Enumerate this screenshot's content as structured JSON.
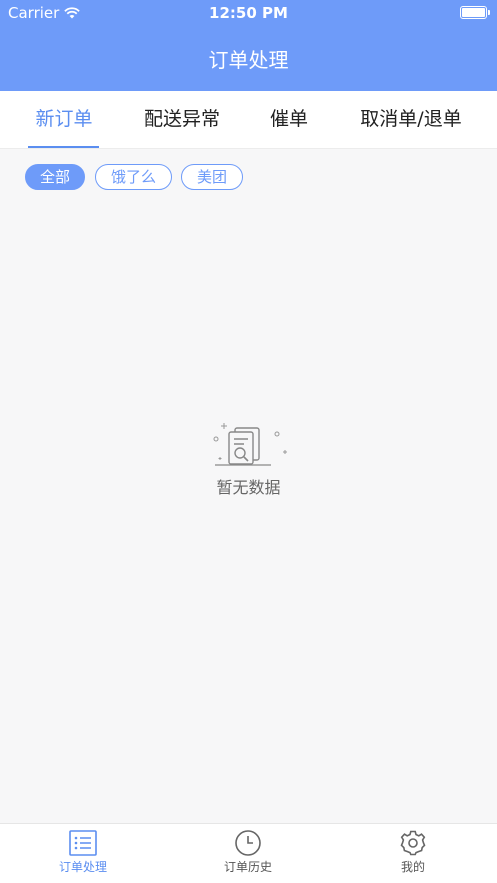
{
  "status_bar": {
    "carrier": "Carrier",
    "time": "12:50 PM",
    "icons": [
      "wifi-icon",
      "battery-icon"
    ]
  },
  "header": {
    "title": "订单处理"
  },
  "tabs": [
    {
      "label": "新订单",
      "active": true
    },
    {
      "label": "配送异常",
      "active": false
    },
    {
      "label": "催单",
      "active": false
    },
    {
      "label": "取消单/退单",
      "active": false
    }
  ],
  "filters": [
    {
      "label": "全部",
      "active": true
    },
    {
      "label": "饿了么",
      "active": false
    },
    {
      "label": "美团",
      "active": false
    }
  ],
  "empty_state": {
    "icon": "empty-document-search-icon",
    "text": "暂无数据"
  },
  "tabbar": [
    {
      "label": "订单处理",
      "icon": "list-icon",
      "active": true
    },
    {
      "label": "订单历史",
      "icon": "clock-icon",
      "active": false
    },
    {
      "label": "我的",
      "icon": "gear-icon",
      "active": false
    }
  ],
  "colors": {
    "primary": "#6e9bf9",
    "active_text": "#5b8ef0",
    "background": "#f7f7f8"
  }
}
